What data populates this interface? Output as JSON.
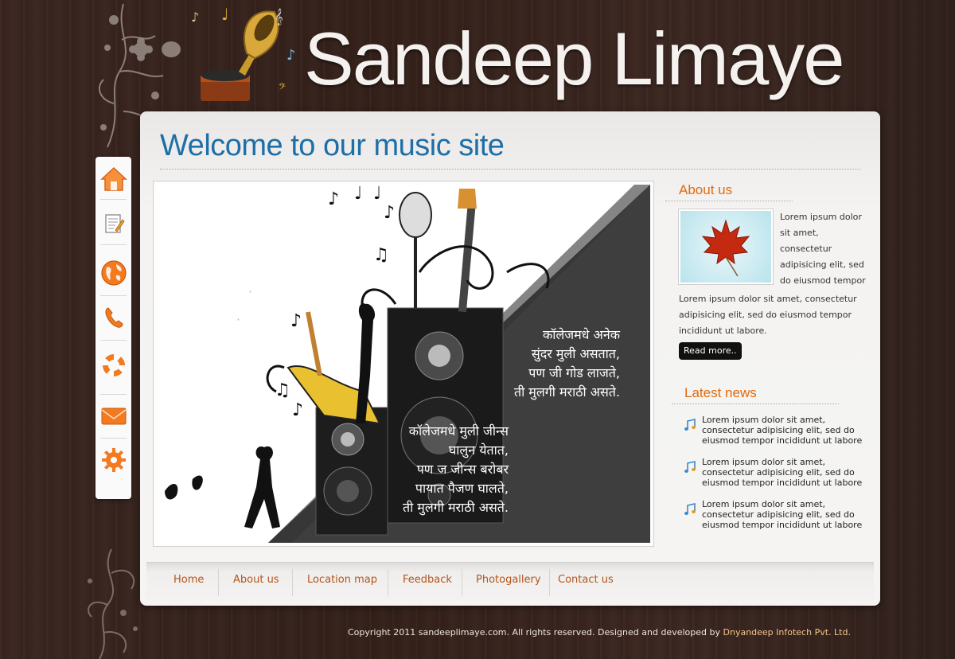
{
  "header": {
    "site_title": "Sandeep Limaye"
  },
  "sidebar": {
    "items": [
      {
        "icon": "home-icon"
      },
      {
        "icon": "notepad-icon"
      },
      {
        "icon": "globe-icon"
      },
      {
        "icon": "phone-icon"
      },
      {
        "icon": "lifebuoy-icon"
      },
      {
        "icon": "mail-icon"
      },
      {
        "icon": "gear-icon"
      }
    ]
  },
  "main": {
    "welcome_title": "Welcome to our music site",
    "banner": {
      "poem_stanza1": [
        "कॉलेजमधे अनेक",
        "सुंदर मुली असतात,",
        "पण जी गोड लाजते,",
        "ती मुलगी मराठी असते."
      ],
      "poem_stanza2": [
        "कॉलेजमधे मुली जीन्स",
        "घालुन येतात,",
        "पण ज जीन्स बरोबर",
        "पायात पैजण घालते,",
        "ती मुलगी मराठी असते."
      ]
    }
  },
  "about": {
    "title": "About us",
    "text_side": "Lorem ipsum dolor sit amet, consectetur adipisicing elit, sed do eiusmod tempor",
    "text_full": "Lorem ipsum dolor sit amet, consectetur adipisicing elit, sed do eiusmod tempor incididunt ut labore.",
    "read_more": "Read more.."
  },
  "news": {
    "title": "Latest news",
    "items": [
      "Lorem ipsum dolor sit amet, consectetur adipisicing elit, sed do eiusmod tempor incididunt ut labore",
      "Lorem ipsum dolor sit amet, consectetur adipisicing elit, sed do eiusmod tempor incididunt ut labore",
      "Lorem ipsum dolor sit amet, consectetur adipisicing elit, sed do eiusmod tempor incididunt ut labore"
    ]
  },
  "nav": {
    "links": [
      "Home",
      "About us",
      "Location map",
      "Feedback",
      "Photogallery",
      "Contact us"
    ]
  },
  "footer": {
    "text": "Copyright 2011 sandeeplimaye.com. All rights reserved. Designed and developed by ",
    "company": "Dnyandeep Infotech Pvt. Ltd."
  },
  "colors": {
    "accent_orange": "#e26a0c",
    "title_blue": "#1e6fa7",
    "nav_link": "#b5541a",
    "wood_dark": "#3a2520"
  }
}
